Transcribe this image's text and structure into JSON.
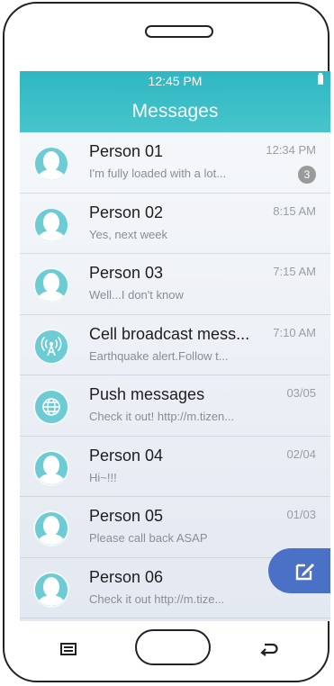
{
  "status_bar": {
    "time": "12:45 PM"
  },
  "header": {
    "title": "Messages"
  },
  "messages": [
    {
      "name": "Person 01",
      "preview": "I'm fully loaded with a lot...",
      "time": "12:34 PM",
      "unread": "3",
      "avatar": "person"
    },
    {
      "name": "Person 02",
      "preview": "Yes, next week",
      "time": "8:15 AM",
      "avatar": "person"
    },
    {
      "name": "Person 03",
      "preview": "Well...I don't know",
      "time": "7:15 AM",
      "avatar": "person"
    },
    {
      "name": "Cell broadcast mess...",
      "preview": "Earthquake alert.Follow t...",
      "time": "7:10 AM",
      "avatar": "broadcast-icon"
    },
    {
      "name": "Push messages",
      "preview": "Check it out! http://m.tizen...",
      "time": "03/05",
      "avatar": "globe-icon"
    },
    {
      "name": "Person 04",
      "preview": "Hi~!!!",
      "time": "02/04",
      "avatar": "person"
    },
    {
      "name": "Person 05",
      "preview": "Please call back ASAP",
      "time": "01/03",
      "avatar": "person"
    },
    {
      "name": "Person 06",
      "preview": "Check it out http://m.tize...",
      "time": "",
      "avatar": "person"
    }
  ],
  "fab": {
    "icon": "compose-icon"
  },
  "colors": {
    "header": "#3dbfc6",
    "avatar": "#6dcbd3",
    "fab": "#4a71c6",
    "badge": "#9a9a9a"
  }
}
